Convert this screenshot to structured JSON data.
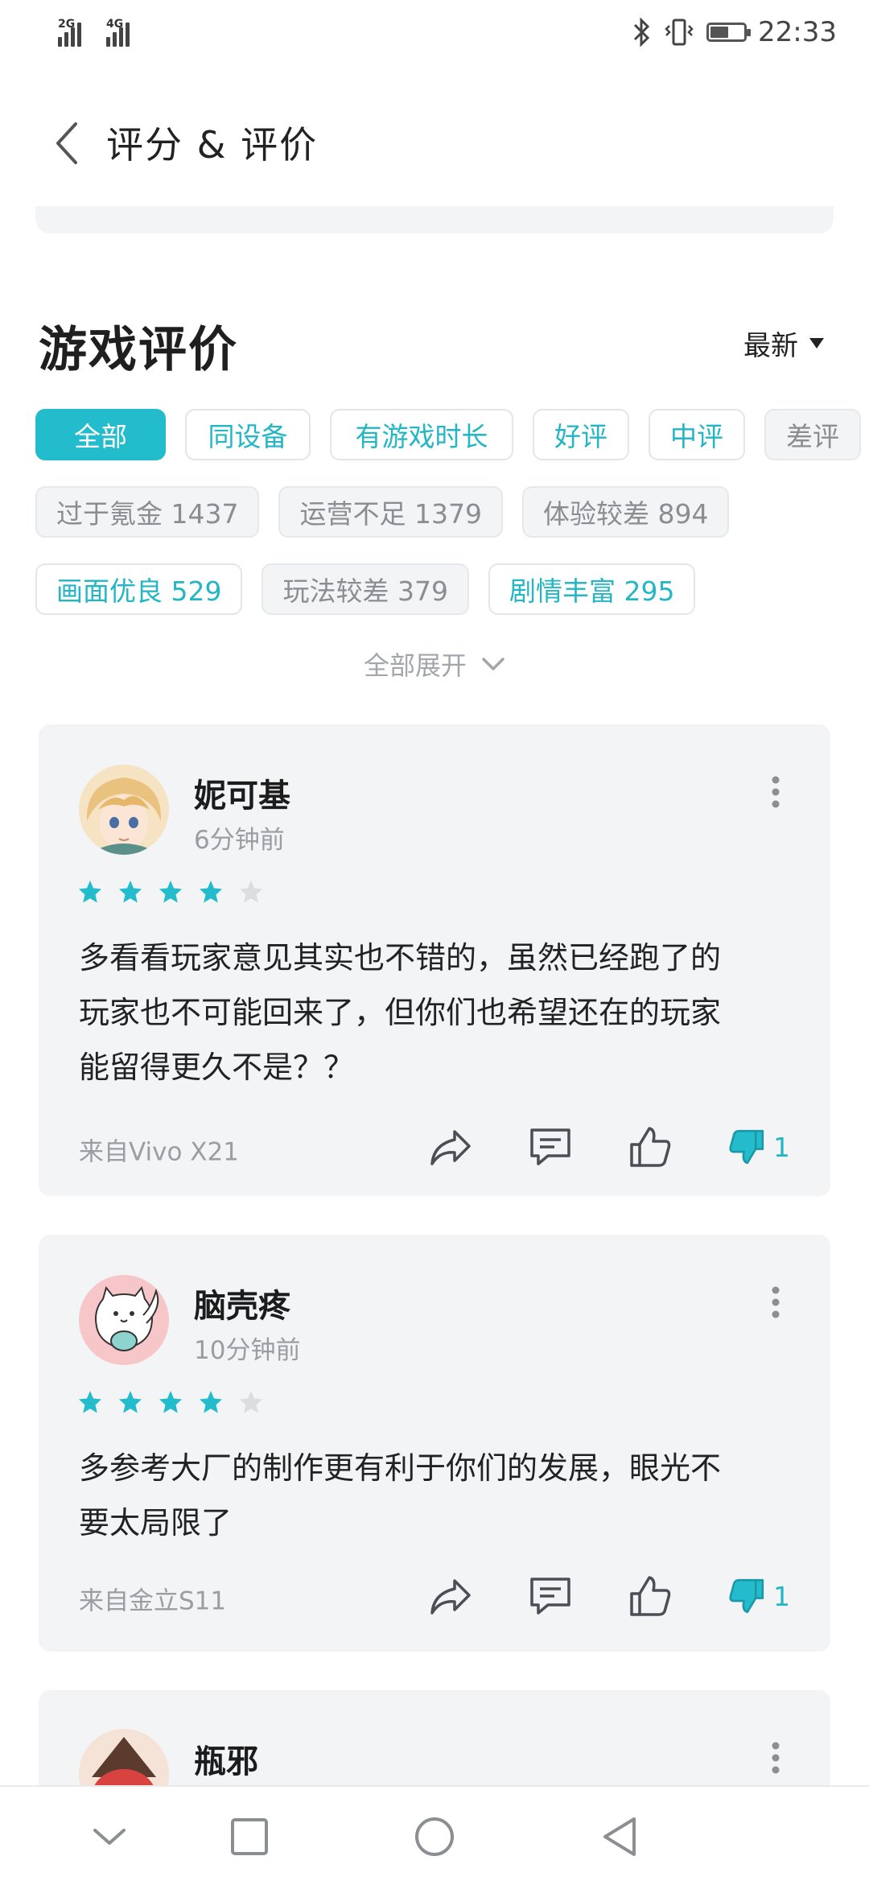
{
  "status_bar": {
    "signal_1": "2G",
    "signal_2": "4G",
    "time": "22:33",
    "battery_level": 0.55
  },
  "header": {
    "title": "评分 & 评价"
  },
  "section": {
    "title": "游戏评价",
    "sort_label": "最新"
  },
  "filters": {
    "row1": [
      "全部",
      "同设备",
      "有游戏时长",
      "好评",
      "中评",
      "差评"
    ],
    "row2": [
      "过于氪金 1437",
      "运营不足 1379",
      "体验较差 894"
    ],
    "row3": [
      "画面优良 529",
      "玩法较差 379",
      "剧情丰富 295"
    ],
    "expand_label": "全部展开"
  },
  "reviews": [
    {
      "name": "妮可基",
      "time": "6分钟前",
      "rating": 4,
      "text_lines": [
        "多看看玩家意见其实也不错的，虽然已经跑了的",
        "玩家也不可能回来了，但你们也希望还在的玩家",
        "能留得更久不是？？"
      ],
      "device": "来自Vivo X21",
      "downvotes": "1"
    },
    {
      "name": "脑壳疼",
      "time": "10分钟前",
      "rating": 4,
      "text_lines": [
        "多参考大厂的制作更有利于你们的发展，眼光不",
        "要太局限了"
      ],
      "device": "来自金立S11",
      "downvotes": "1"
    },
    {
      "name": "瓶邪"
    }
  ],
  "colors": {
    "accent": "#23bccc",
    "card_bg": "#f3f4f6",
    "star_empty": "#dcdde0"
  }
}
